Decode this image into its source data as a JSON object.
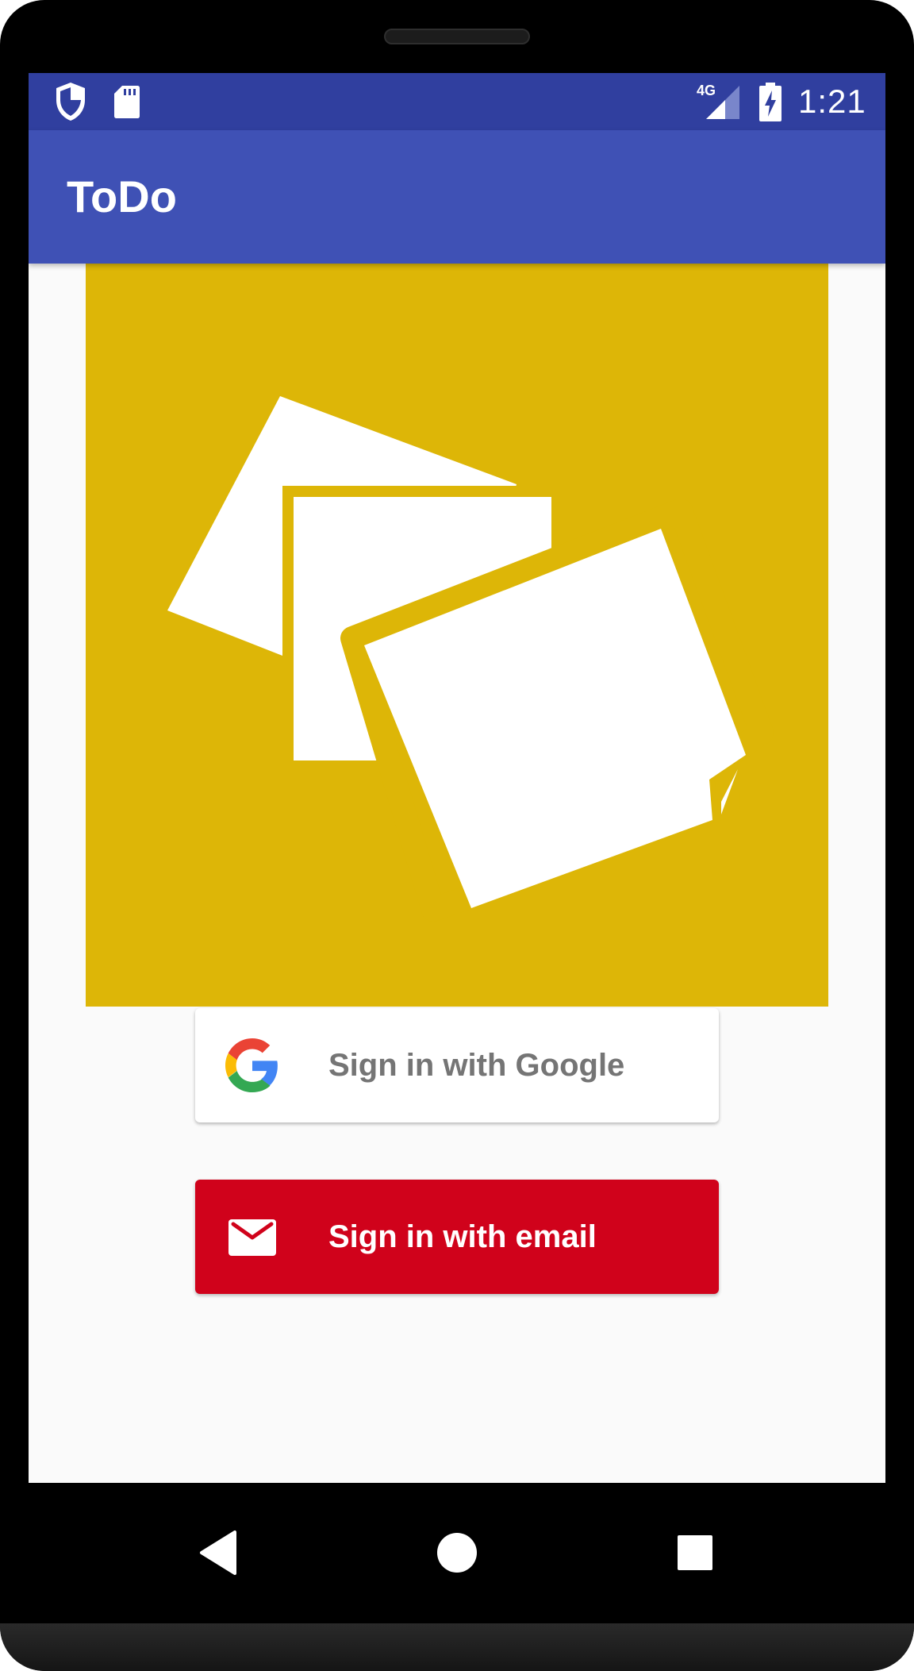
{
  "status_bar": {
    "time": "1:21",
    "network_label": "4G",
    "icons": [
      "shield-icon",
      "sd-card-icon",
      "signal-icon",
      "battery-charging-icon"
    ]
  },
  "app_bar": {
    "title": "ToDo"
  },
  "logo": {
    "icon": "sticky-notes-icon",
    "background_color": "#ddb607"
  },
  "auth": {
    "google_label": "Sign in with Google",
    "email_label": "Sign in with email",
    "google_icon": "google-g-icon",
    "email_icon": "envelope-icon",
    "email_button_color": "#d0021b"
  },
  "nav_bar": {
    "icons": [
      "back-icon",
      "home-icon",
      "recents-icon"
    ]
  },
  "colors": {
    "status_bar": "#303f9f",
    "app_bar": "#3f51b5"
  }
}
